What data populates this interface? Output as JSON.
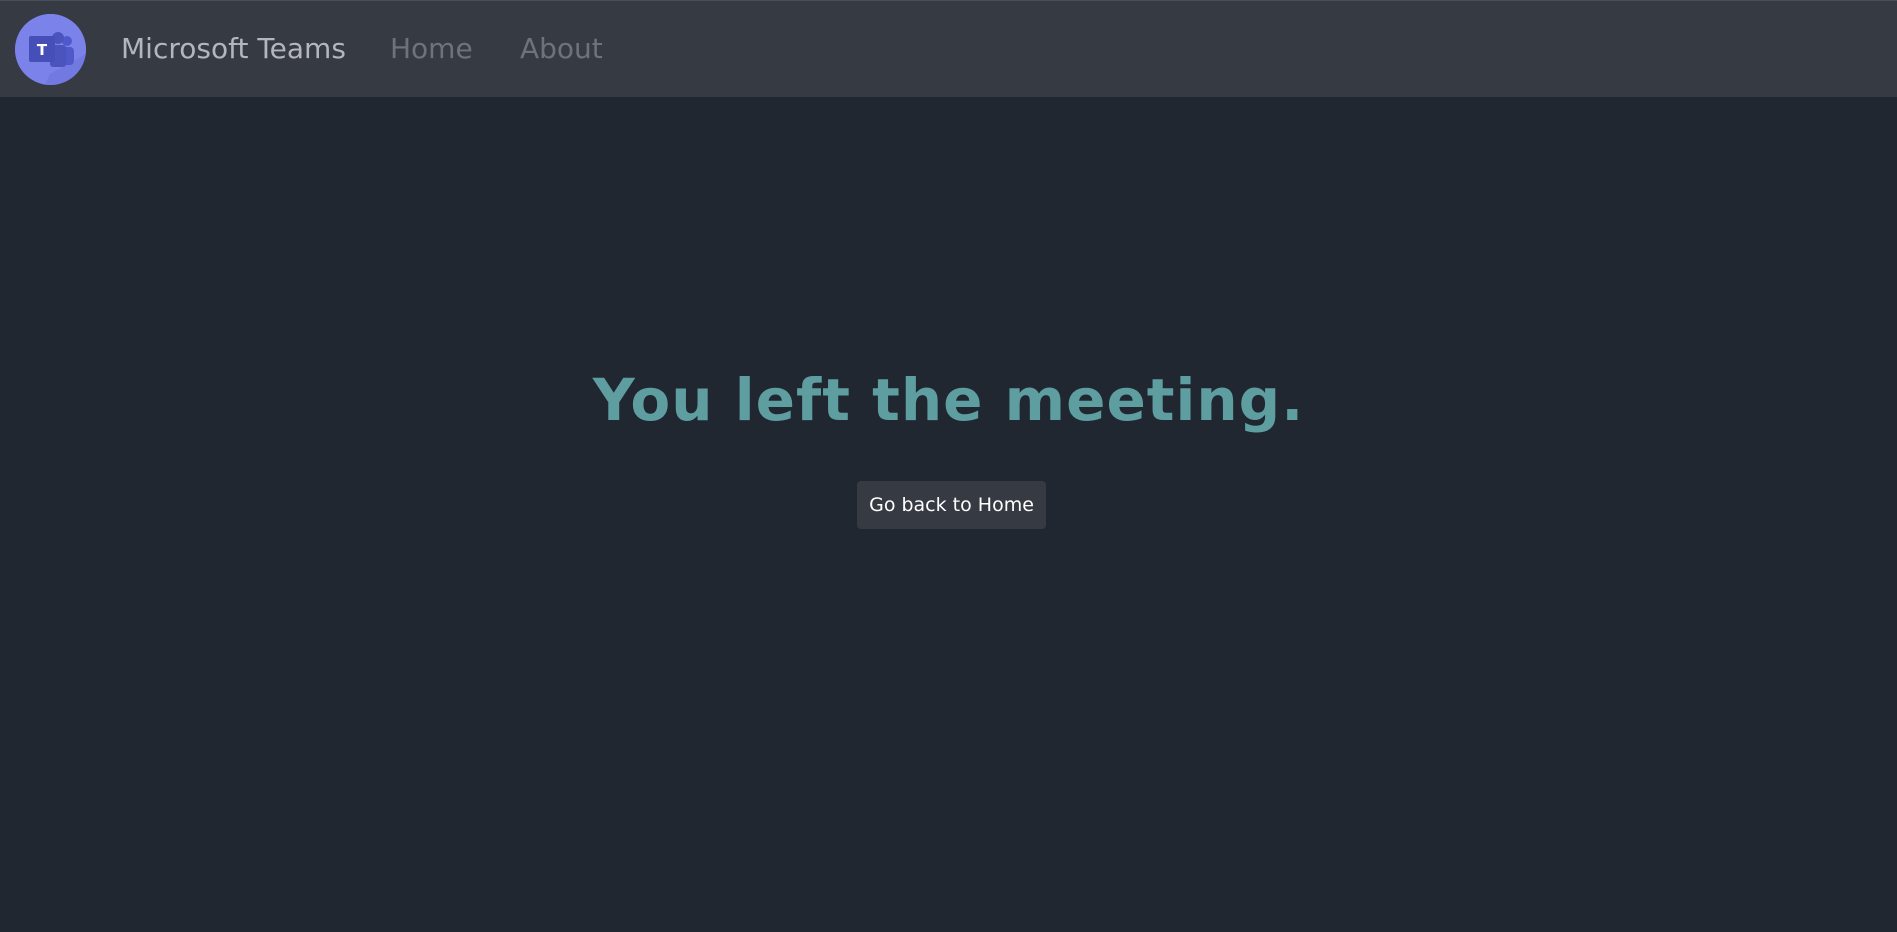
{
  "navbar": {
    "logo_icon": "microsoft-teams-logo",
    "brand": "Microsoft Teams",
    "links": [
      {
        "label": "Home"
      },
      {
        "label": "About"
      }
    ]
  },
  "main": {
    "headline": "You left the meeting.",
    "home_button_label": "Go back to Home"
  },
  "colors": {
    "background": "#212731",
    "navbar": "#363a42",
    "headline": "#5e9ea0",
    "logo": "#7b83eb"
  }
}
